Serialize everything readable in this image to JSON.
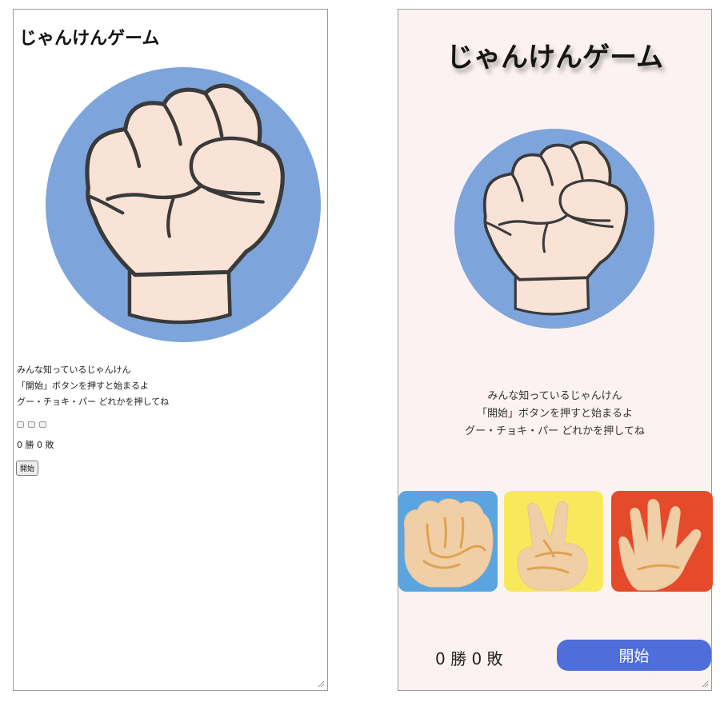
{
  "title": "じゃんけんゲーム",
  "instructions": {
    "line1": "みんな知っているじゃんけん",
    "line2": "「開始」ボタンを押すと始まるよ",
    "line3": "グー・チョキ・パー どれかを押してね"
  },
  "score": {
    "text": "0 勝 0 敗"
  },
  "start_button": {
    "label": "開始"
  },
  "opponent_hand": {
    "icon": "fist-icon",
    "circle_color": "#7da5dc"
  },
  "hand_buttons": [
    {
      "name": "グー",
      "icon": "rock-hand-icon",
      "color": "#5aa5e0"
    },
    {
      "name": "チョキ",
      "icon": "scissors-hand-icon",
      "color": "#f8e85c"
    },
    {
      "name": "パー",
      "icon": "paper-hand-icon",
      "color": "#e54a2b"
    }
  ],
  "colors": {
    "start_button": "#4f6ed9",
    "background": "#fcf2f1"
  }
}
